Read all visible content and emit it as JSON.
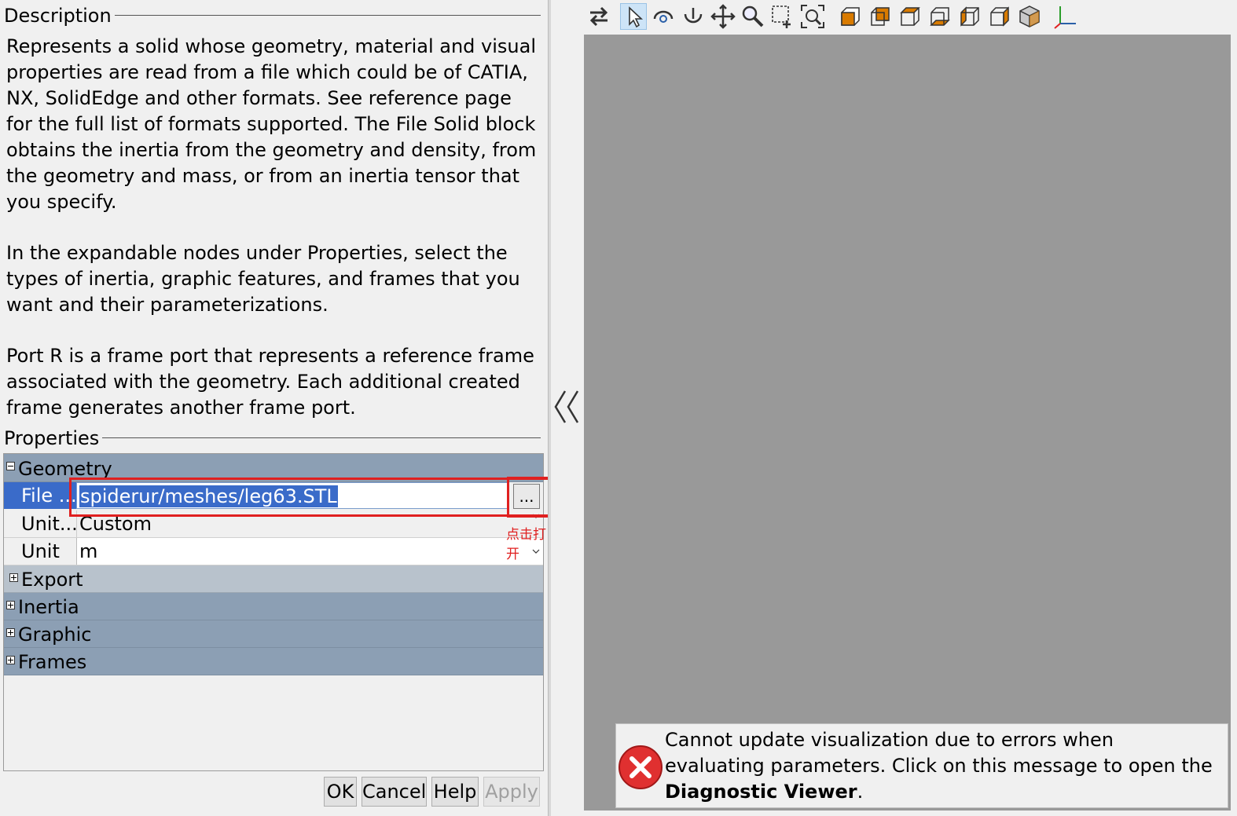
{
  "description": {
    "title": "Description",
    "paragraphs": [
      "Represents a solid whose geometry, material and visual properties are read from a file which could be of CATIA, NX, SolidEdge and other formats. See reference page for the full list of formats supported. The File Solid block obtains the inertia from the geometry and density, from the geometry and mass, or from an inertia tensor that you specify.",
      "In the expandable nodes under Properties, select the types of inertia, graphic features, and frames that you want and their parameterizations.",
      "Port R is a frame port that represents a reference frame associated with the geometry. Each additional created frame generates another frame port."
    ]
  },
  "properties": {
    "title": "Properties",
    "geometry_label": "Geometry",
    "file_name_label": "File ...",
    "file_name_value": "spiderur/meshes/leg63.STL",
    "browse_label": "...",
    "units_label": "Unit...",
    "units_value": "Custom",
    "unit_label": "Unit",
    "unit_value": "m",
    "export_label": "Export",
    "inertia_label": "Inertia",
    "graphic_label": "Graphic",
    "frames_label": "Frames"
  },
  "annotation": {
    "text": "点击打开",
    "color": "#e02020"
  },
  "buttons": {
    "ok": "OK",
    "cancel": "Cancel",
    "help": "Help",
    "apply": "Apply"
  },
  "error": {
    "text_before": "Cannot update visualization due to errors when evaluating parameters. Click on this message to open the ",
    "link_text": "Diagnostic Viewer",
    "text_after": "."
  },
  "colors": {
    "selection": "#3a6bc9",
    "node": "#8c9fb4",
    "viewport": "#999999",
    "error_icon": "#e03030"
  }
}
